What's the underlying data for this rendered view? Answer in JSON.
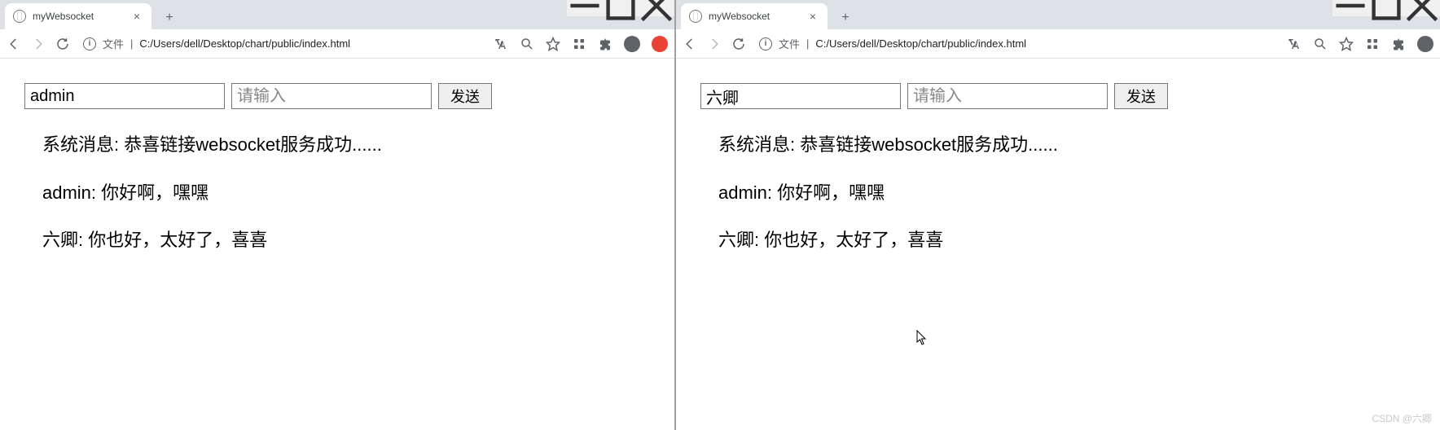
{
  "left": {
    "tab_title": "myWebsocket",
    "url_prefix": "文件",
    "url": "C:/Users/dell/Desktop/chart/public/index.html",
    "name_value": "admin",
    "msg_placeholder": "请输入",
    "send_label": "发送",
    "messages": [
      "系统消息: 恭喜链接websocket服务成功......",
      "admin: 你好啊，嘿嘿",
      "六卿: 你也好，太好了，喜喜"
    ]
  },
  "right": {
    "tab_title": "myWebsocket",
    "url_prefix": "文件",
    "url": "C:/Users/dell/Desktop/chart/public/index.html",
    "name_value": "六卿",
    "msg_placeholder": "请输入",
    "send_label": "发送",
    "messages": [
      "系统消息: 恭喜链接websocket服务成功......",
      "admin: 你好啊，嘿嘿",
      "六卿: 你也好，太好了，喜喜"
    ]
  },
  "watermark": "CSDN @六卿"
}
